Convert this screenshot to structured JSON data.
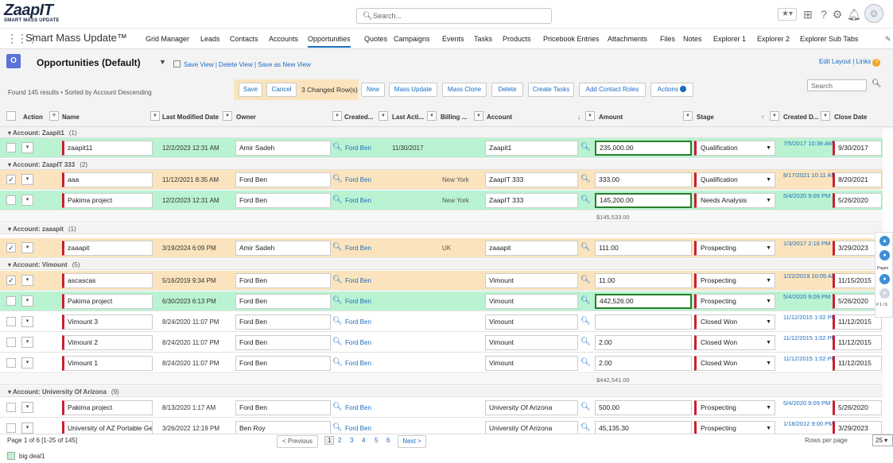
{
  "header": {
    "logo_main": "ZaapIT",
    "logo_sub": "SMART MASS UPDATE",
    "search_placeholder": "Search..."
  },
  "nav": {
    "app_title": "Smart Mass Update™",
    "items": [
      "Grid Manager",
      "Leads",
      "Contacts",
      "Accounts",
      "Opportunities",
      "Quotes",
      "Campaigns",
      "Events",
      "Tasks",
      "Products",
      "Pricebook Entries",
      "Attachments",
      "Files",
      "Notes",
      "Explorer 1",
      "Explorer 2",
      "Explorer Sub Tabs"
    ],
    "active": "Opportunities"
  },
  "view": {
    "icon_letter": "O",
    "name": "Opportunities (Default)",
    "links": "Save View | Delete View | Save as New View",
    "edit_layout": "Edit Layout | Links"
  },
  "toolbar": {
    "found_text": "Found 145 results • Sorted by Account Descending",
    "save": "Save",
    "cancel": "Cancel",
    "changed": "3 Changed Row(s)",
    "new": "New",
    "mass_update": "Mass Update",
    "mass_clone": "Mass Clone",
    "delete": "Delete",
    "create_tasks": "Create Tasks",
    "add_contact_roles": "Add Contact Roles",
    "actions": "Actions",
    "search_placeholder": "Search"
  },
  "columns": {
    "action": "Action",
    "name": "Name",
    "last_modified": "Last Modified Date",
    "owner": "Owner",
    "created": "Created...",
    "last_activity": "Last Acti...",
    "billing": "Billing ...",
    "account": "Account",
    "amount": "Amount",
    "stage": "Stage",
    "created_date": "Created D...",
    "close_date": "Close Date"
  },
  "groups": [
    {
      "label": "Account: Zaapit1",
      "count": "(1)"
    },
    {
      "label": "Account: ZaapIT 333",
      "count": "(2)"
    },
    {
      "label": "Account: zaaapit",
      "count": "(1)"
    },
    {
      "label": "Account: Vimount",
      "count": "(5)"
    },
    {
      "label": "Account: University Of Arizona",
      "count": "(9)"
    }
  ],
  "rows": [
    {
      "checked": false,
      "name": "zaapit11",
      "modified": "12/2/2023 12:31 AM",
      "owner": "Amir Sadeh",
      "created_by": "Ford Ben",
      "last_activity": "11/30/2017",
      "billing": "",
      "account": "Zaapit1",
      "amount": "235,000.00",
      "stage": "Qualification",
      "created_date": "7/5/2017 10:38 AM",
      "close_date": "9/30/2017"
    },
    {
      "checked": true,
      "name": "aaa",
      "modified": "11/12/2021 8:35 AM",
      "owner": "Ford Ben",
      "created_by": "Ford Ben",
      "last_activity": "",
      "billing": "New York",
      "account": "ZaapIT 333",
      "amount": "333.00",
      "stage": "Qualification",
      "created_date": "8/17/2021 10:11 AM",
      "close_date": "8/20/2021"
    },
    {
      "checked": false,
      "name": "Pakima project",
      "modified": "12/2/2023 12:31 AM",
      "owner": "Ford Ben",
      "created_by": "Ford Ben",
      "last_activity": "",
      "billing": "New York",
      "account": "ZaapIT 333",
      "amount": "145,200.00",
      "stage": "Needs Analysis",
      "created_date": "5/4/2020 9:09 PM",
      "close_date": "5/26/2020"
    },
    {
      "checked": true,
      "name": "zaaapit",
      "modified": "3/19/2024 6:09 PM",
      "owner": "Amir Sadeh",
      "created_by": "Ford Ben",
      "last_activity": "",
      "billing": "UK",
      "account": "zaaapit",
      "amount": "111.00",
      "stage": "Prospecting",
      "created_date": "1/3/2017 2:16 PM",
      "close_date": "3/29/2023"
    },
    {
      "checked": true,
      "name": "ascascas",
      "modified": "5/16/2019 9:34 PM",
      "owner": "Ford Ben",
      "created_by": "Ford Ben",
      "last_activity": "",
      "billing": "",
      "account": "Vimount",
      "amount": "11.00",
      "stage": "Prospecting",
      "created_date": "1/22/2019 10:05 AM",
      "close_date": "11/15/2015"
    },
    {
      "checked": false,
      "name": "Pakima project",
      "modified": "6/30/2023 6:13 PM",
      "owner": "Ford Ben",
      "created_by": "Ford Ben",
      "last_activity": "",
      "billing": "",
      "account": "Vimount",
      "amount": "442,526.00",
      "stage": "Prospecting",
      "created_date": "5/4/2020 9:09 PM",
      "close_date": "5/26/2020"
    },
    {
      "checked": false,
      "name": "Vimount 3",
      "modified": "8/24/2020 11:07 PM",
      "owner": "Ford Ben",
      "created_by": "Ford Ben",
      "last_activity": "",
      "billing": "",
      "account": "Vimount",
      "amount": "",
      "stage": "Closed Won",
      "created_date": "11/12/2015 1:02 PM",
      "close_date": "11/12/2015"
    },
    {
      "checked": false,
      "name": "Vimount 2",
      "modified": "8/24/2020 11:07 PM",
      "owner": "Ford Ben",
      "created_by": "Ford Ben",
      "last_activity": "",
      "billing": "",
      "account": "Vimount",
      "amount": "2.00",
      "stage": "Closed Won",
      "created_date": "11/12/2015 1:02 PM",
      "close_date": "11/12/2015"
    },
    {
      "checked": false,
      "name": "Vimount 1",
      "modified": "8/24/2020 11:07 PM",
      "owner": "Ford Ben",
      "created_by": "Ford Ben",
      "last_activity": "",
      "billing": "",
      "account": "Vimount",
      "amount": "2.00",
      "stage": "Closed Won",
      "created_date": "11/12/2015 1:02 PM",
      "close_date": "11/12/2015"
    },
    {
      "checked": false,
      "name": "Pakima project",
      "modified": "8/13/2020 1:17 AM",
      "owner": "Ford Ben",
      "created_by": "Ford Ben",
      "last_activity": "",
      "billing": "",
      "account": "University Of Arizona",
      "amount": "500.00",
      "stage": "Prospecting",
      "created_date": "5/4/2020 9:09 PM",
      "close_date": "5/26/2020"
    },
    {
      "checked": false,
      "name": "University of AZ Portable Ge",
      "modified": "3/26/2022 12:19 PM",
      "owner": "Ben Roy",
      "created_by": "Ford Ben",
      "last_activity": "",
      "billing": "",
      "account": "University Of Arizona",
      "amount": "45,135.30",
      "stage": "Prospecting",
      "created_date": "1/18/2012 9:00 PM",
      "close_date": "3/29/2023"
    }
  ],
  "subtotals": [
    "$145,533.00",
    "$442,541.00"
  ],
  "footer": {
    "page_info": "Page 1 of 6  [1-25 of 145]",
    "previous": "< Previous",
    "pages": [
      "1",
      "2",
      "3",
      "4",
      "5",
      "6"
    ],
    "next": "Next >",
    "rows_per_page_label": "Rows per page",
    "rows_per_page": "25",
    "legend_label": "big deal1"
  },
  "side": {
    "pages_label": "Pages",
    "page_count": "# 1 / 6"
  }
}
